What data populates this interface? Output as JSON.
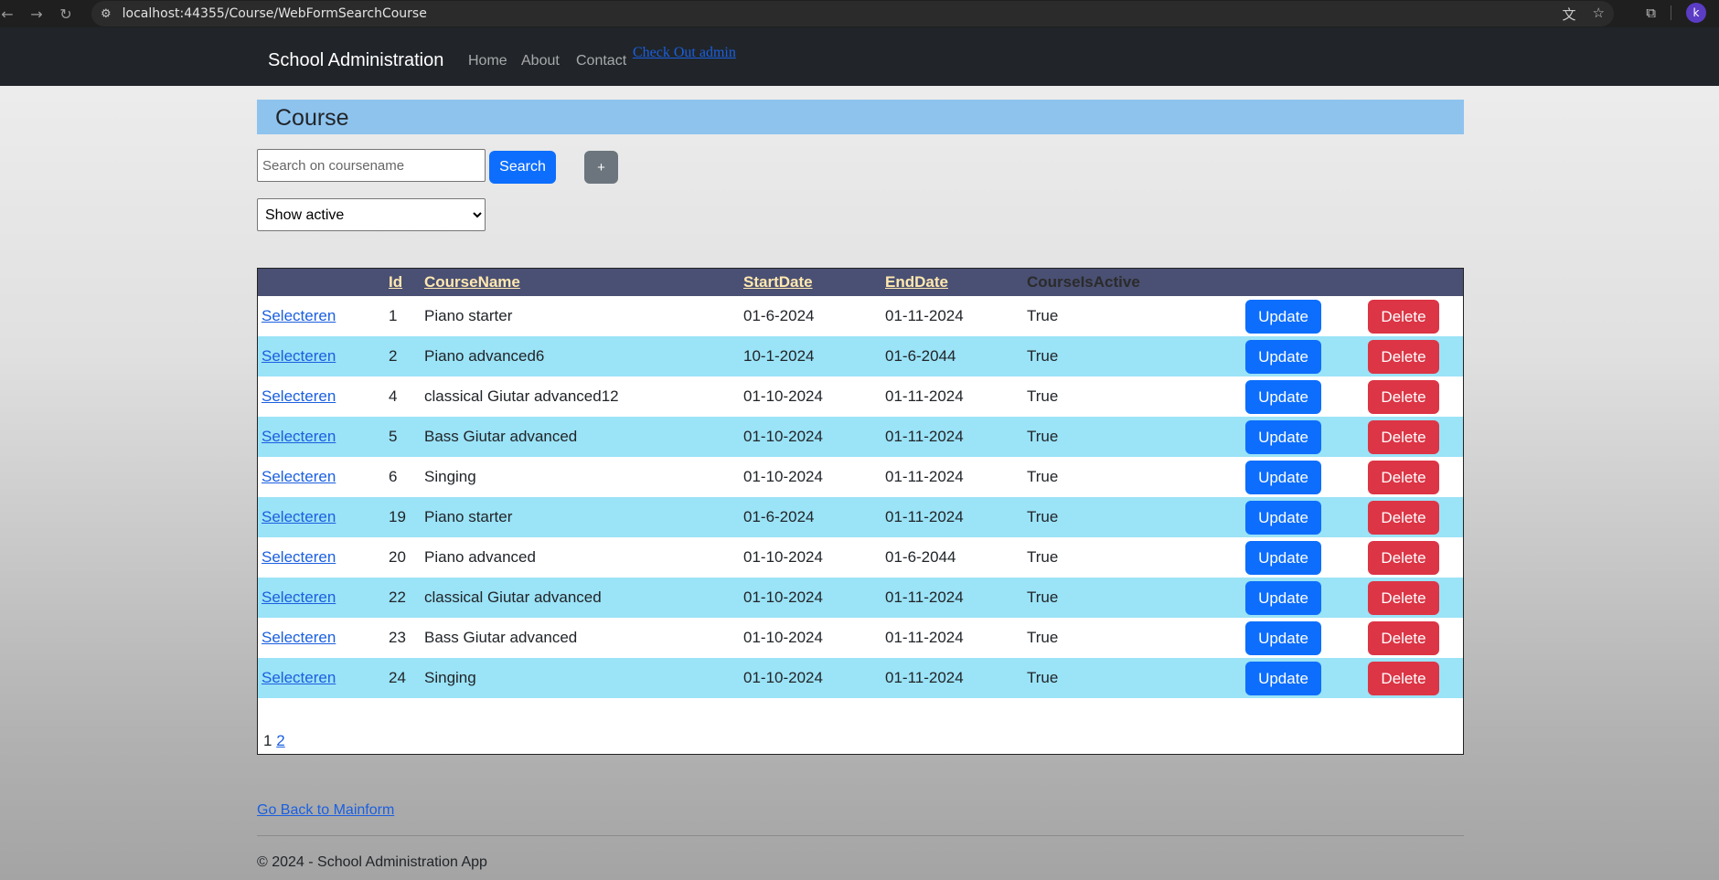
{
  "browser": {
    "url": "localhost:44355/Course/WebFormSearchCourse",
    "back_icon": "arrow-left-icon",
    "forward_icon": "arrow-right-icon",
    "reload_icon": "reload-icon",
    "avatar_letter": "k"
  },
  "navbar": {
    "brand": "School Administration",
    "links": [
      "Home",
      "About",
      "Contact"
    ],
    "checkout": "Check Out admin"
  },
  "page": {
    "title": "Course",
    "search_placeholder": "Search on coursename",
    "search_button": "Search",
    "add_button": "+",
    "filter_selected": "Show active"
  },
  "grid": {
    "columns": [
      "",
      "Id",
      "CourseName",
      "StartDate",
      "EndDate",
      "CourseIsActive"
    ],
    "select_label": "Selecteren",
    "update_label": "Update",
    "delete_label": "Delete",
    "rows": [
      {
        "id": "1",
        "name": "Piano starter",
        "start": "01-6-2024",
        "end": "01-11-2024",
        "active": "True"
      },
      {
        "id": "2",
        "name": "Piano advanced6",
        "start": "10-1-2024",
        "end": "01-6-2044",
        "active": "True"
      },
      {
        "id": "4",
        "name": "classical Giutar advanced12",
        "start": "01-10-2024",
        "end": "01-11-2024",
        "active": "True"
      },
      {
        "id": "5",
        "name": "Bass Giutar advanced",
        "start": "01-10-2024",
        "end": "01-11-2024",
        "active": "True"
      },
      {
        "id": "6",
        "name": "Singing",
        "start": "01-10-2024",
        "end": "01-11-2024",
        "active": "True"
      },
      {
        "id": "19",
        "name": "Piano starter",
        "start": "01-6-2024",
        "end": "01-11-2024",
        "active": "True"
      },
      {
        "id": "20",
        "name": "Piano advanced",
        "start": "01-10-2024",
        "end": "01-6-2044",
        "active": "True"
      },
      {
        "id": "22",
        "name": "classical Giutar advanced",
        "start": "01-10-2024",
        "end": "01-11-2024",
        "active": "True"
      },
      {
        "id": "23",
        "name": "Bass Giutar advanced",
        "start": "01-10-2024",
        "end": "01-11-2024",
        "active": "True"
      },
      {
        "id": "24",
        "name": "Singing",
        "start": "01-10-2024",
        "end": "01-11-2024",
        "active": "True"
      }
    ],
    "pager_current": "1",
    "pager_next": "2"
  },
  "footer": {
    "back_link": "Go Back to Mainform",
    "copyright": "© 2024 - School Administration App"
  },
  "colors": {
    "primary": "#0d6efd",
    "danger": "#dc3545",
    "secondary": "#6c757d",
    "header_band": "#8ec3ee",
    "row_alt": "#9be3f7",
    "grid_header": "#4a5073"
  }
}
